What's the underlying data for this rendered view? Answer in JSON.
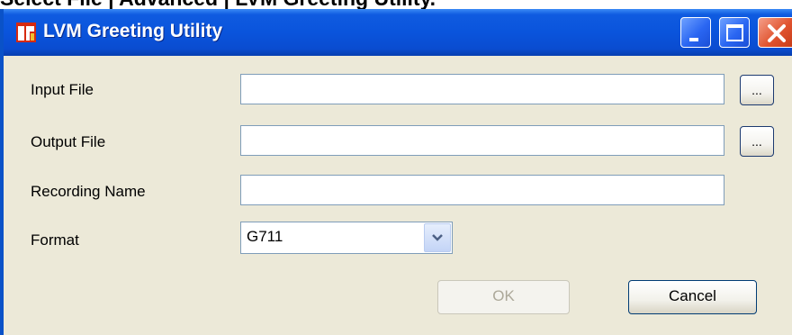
{
  "page": {
    "heading": "Select File | Advanced | LVM Greeting Utility."
  },
  "window": {
    "title": "LVM Greeting Utility"
  },
  "form": {
    "input_file": {
      "label": "Input File",
      "value": "",
      "browse_label": "..."
    },
    "output_file": {
      "label": "Output File",
      "value": "",
      "browse_label": "..."
    },
    "recording_name": {
      "label": "Recording Name",
      "value": ""
    },
    "format": {
      "label": "Format",
      "value": "G711"
    }
  },
  "buttons": {
    "ok": "OK",
    "cancel": "Cancel"
  },
  "colors": {
    "titlebar": "#0a54dc",
    "dialog_bg": "#ece9d8",
    "close_button": "#e0522e",
    "field_border": "#7f9db9"
  }
}
